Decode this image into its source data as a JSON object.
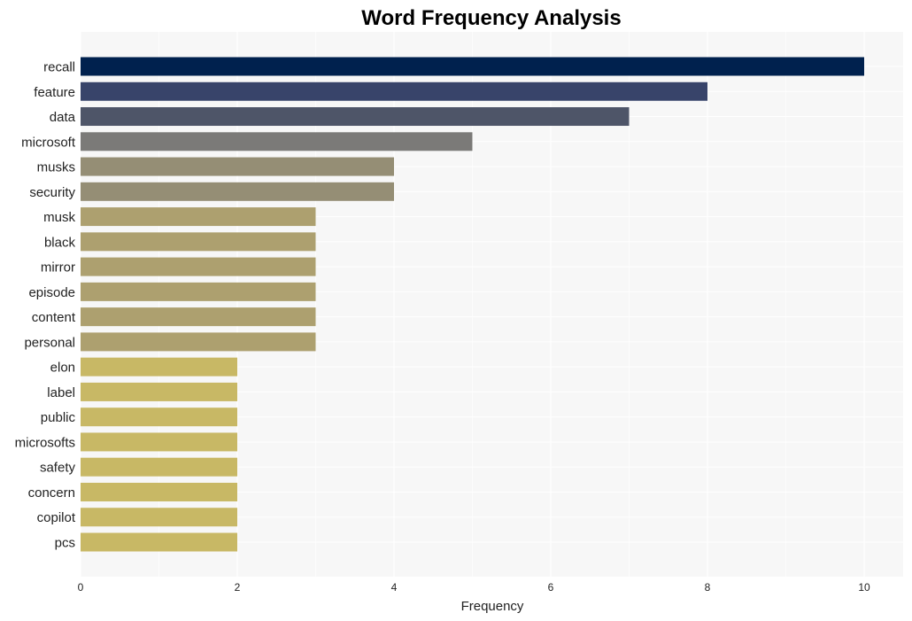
{
  "chart_data": {
    "type": "bar",
    "orientation": "horizontal",
    "title": "Word Frequency Analysis",
    "xlabel": "Frequency",
    "ylabel": "",
    "xlim": [
      0,
      10.5
    ],
    "xticks": [
      0,
      2,
      4,
      6,
      8,
      10
    ],
    "grid": true,
    "categories": [
      "recall",
      "feature",
      "data",
      "microsoft",
      "musks",
      "security",
      "musk",
      "black",
      "mirror",
      "episode",
      "content",
      "personal",
      "elon",
      "label",
      "public",
      "microsofts",
      "safety",
      "concern",
      "copilot",
      "pcs"
    ],
    "values": [
      10,
      8,
      7,
      5,
      4,
      4,
      3,
      3,
      3,
      3,
      3,
      3,
      2,
      2,
      2,
      2,
      2,
      2,
      2,
      2
    ],
    "colors": [
      "#00214e",
      "#38446a",
      "#4e5568",
      "#7b7a78",
      "#958e75",
      "#958e75",
      "#ada06f",
      "#ada06f",
      "#ada06f",
      "#ada06f",
      "#ada06f",
      "#ada06f",
      "#c8b865",
      "#c8b865",
      "#c8b865",
      "#c8b865",
      "#c8b865",
      "#c8b865",
      "#c8b865",
      "#c8b865"
    ],
    "background": "#f7f7f7"
  }
}
